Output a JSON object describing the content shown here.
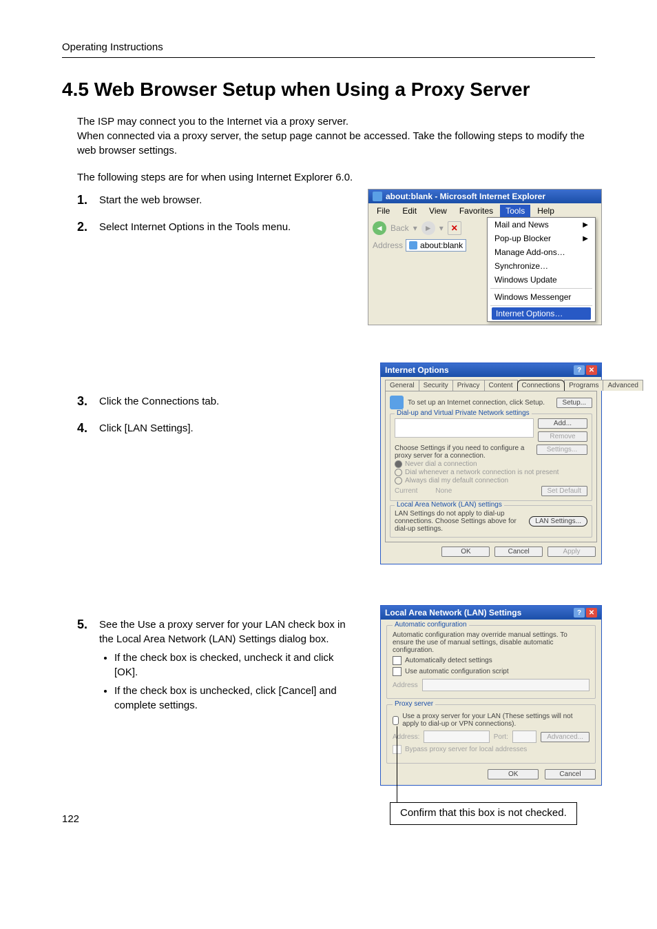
{
  "running_head": "Operating Instructions",
  "section_title": "4.5    Web Browser Setup when Using a Proxy Server",
  "intro": "The ISP may connect you to the Internet via a proxy server.\nWhen connected via a proxy server, the setup page cannot be accessed. Take the following steps to modify the web browser settings.",
  "preface": "The following steps are for when using Internet Explorer 6.0.",
  "steps": {
    "s1": "Start the web browser.",
    "s2": "Select Internet Options in the Tools menu.",
    "s3": "Click the Connections tab.",
    "s4": "Click [LAN Settings].",
    "s5_lead": "See the Use a proxy server for your LAN check box in the Local Area Network (LAN) Settings dialog box.",
    "s5_b1": "If the check box is checked, uncheck it and click [OK].",
    "s5_b2": "If the check box is unchecked, click [Cancel] and complete settings."
  },
  "fig1": {
    "title": "about:blank - Microsoft Internet Explorer",
    "menus": {
      "file": "File",
      "edit": "Edit",
      "view": "View",
      "favorites": "Favorites",
      "tools": "Tools",
      "help": "Help"
    },
    "toolbar": {
      "back": "Back",
      "address_label": "Address",
      "address_value": "about:blank"
    },
    "tools_menu": {
      "mail": "Mail and News",
      "popup": "Pop-up Blocker",
      "addons": "Manage Add-ons…",
      "sync": "Synchronize…",
      "update": "Windows Update",
      "messenger": "Windows Messenger",
      "options": "Internet Options…"
    }
  },
  "fig2": {
    "title": "Internet Options",
    "tabs": {
      "general": "General",
      "security": "Security",
      "privacy": "Privacy",
      "content": "Content",
      "connections": "Connections",
      "programs": "Programs",
      "advanced": "Advanced"
    },
    "setup_text": "To set up an Internet connection, click Setup.",
    "setup_btn": "Setup...",
    "group1_legend": "Dial-up and Virtual Private Network settings",
    "add_btn": "Add...",
    "remove_btn": "Remove",
    "choose_text": "Choose Settings if you need to configure a proxy server for a connection.",
    "settings_btn": "Settings...",
    "radio1": "Never dial a connection",
    "radio2": "Dial whenever a network connection is not present",
    "radio3": "Always dial my default connection",
    "current_label": "Current",
    "current_value": "None",
    "setdefault_btn": "Set Default",
    "group2_legend": "Local Area Network (LAN) settings",
    "lan_text": "LAN Settings do not apply to dial-up connections. Choose Settings above for dial-up settings.",
    "lan_btn": "LAN Settings...",
    "ok": "OK",
    "cancel": "Cancel",
    "apply": "Apply"
  },
  "fig3": {
    "title": "Local Area Network (LAN) Settings",
    "group1_legend": "Automatic configuration",
    "auto_text": "Automatic configuration may override manual settings. To ensure the use of manual settings, disable automatic configuration.",
    "auto_detect": "Automatically detect settings",
    "auto_script": "Use automatic configuration script",
    "addr_label": "Address",
    "group2_legend": "Proxy server",
    "proxy_text": "Use a proxy server for your LAN (These settings will not apply to dial-up or VPN connections).",
    "addr2_label": "Address:",
    "port_label": "Port:",
    "advanced_btn": "Advanced...",
    "bypass": "Bypass proxy server for local addresses",
    "ok": "OK",
    "cancel": "Cancel",
    "callout": "Confirm that this box is not checked."
  },
  "page_number": "122"
}
